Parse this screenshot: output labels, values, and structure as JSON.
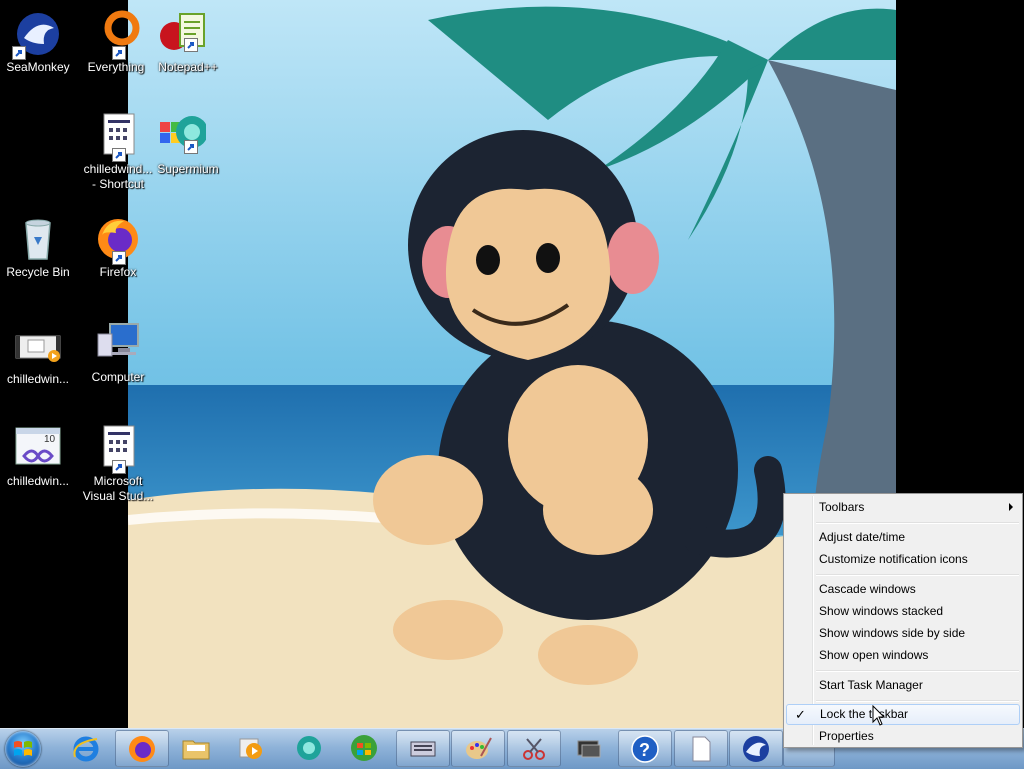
{
  "desktop": {
    "icons": {
      "seamonkey": "SeaMonkey",
      "everything": "Everything",
      "notepadpp": "Notepad++",
      "chilled_shortcut": "chilledwind...\n- Shortcut",
      "supermium": "Supermium",
      "recycle": "Recycle Bin",
      "firefox": "Firefox",
      "chilled1": "chilledwin...",
      "computer": "Computer",
      "chilled2": "chilledwin...",
      "msvs": "Microsoft\nVisual Stud..."
    }
  },
  "context_menu": {
    "toolbars": "Toolbars",
    "adjust_datetime": "Adjust date/time",
    "customize_notif": "Customize notification icons",
    "cascade": "Cascade windows",
    "stacked": "Show windows stacked",
    "side_by_side": "Show windows side by side",
    "show_open": "Show open windows",
    "task_manager": "Start Task Manager",
    "lock_taskbar": "Lock the taskbar",
    "lock_checkmark": "✓",
    "properties": "Properties"
  },
  "taskbar": {
    "pinned": [
      "internet-explorer",
      "firefox",
      "explorer",
      "media-player",
      "supermium",
      "windows-update",
      "on-screen-keyboard",
      "paint",
      "snipping-tool",
      "display",
      "help",
      "notepad",
      "seamonkey"
    ]
  },
  "colors": {
    "menu_bg": "#f0f0f0",
    "taskbar": "#8fb3d9",
    "hover_border": "#aecff7"
  }
}
